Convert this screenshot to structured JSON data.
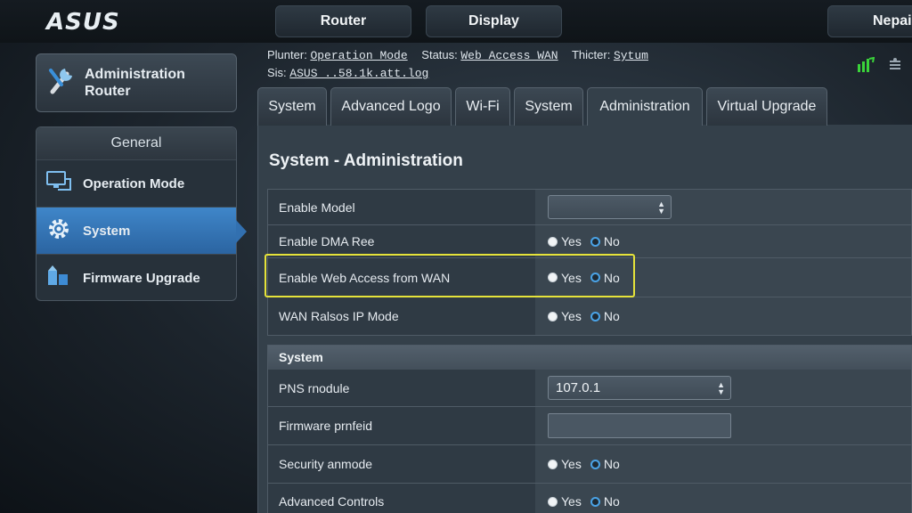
{
  "brand": {
    "logo": "ASUS"
  },
  "top_tabs": [
    "Router",
    "Display",
    "Nepail"
  ],
  "header": {
    "l1_k1": "Plunter:",
    "l1_v1": "Operation Mode",
    "l1_k2": "Status:",
    "l1_v2": "Web Access WAN",
    "l1_k3": "Thicter:",
    "l1_v3": "Sytum",
    "l2_k1": "Sis:",
    "l2_v1": "ASUS ..58.1k.att.log"
  },
  "sidebar": {
    "admin_title_line1": "Administration",
    "admin_title_line2": "Router",
    "section_title": "General",
    "items": [
      {
        "label": "Operation Mode",
        "icon": "monitor-network-icon"
      },
      {
        "label": "System",
        "icon": "gear-icon"
      },
      {
        "label": "Firmware Upgrade",
        "icon": "firmware-upgrade-icon"
      }
    ],
    "active_item": "System"
  },
  "tabs": [
    "System",
    "Advanced Logo",
    "Wi-Fi",
    "System",
    "Administration",
    "Virtual Upgrade"
  ],
  "active_tab": "Administration",
  "page_title": "System - Administration",
  "radio_labels": {
    "yes": "Yes",
    "no": "No"
  },
  "admin_rows": [
    {
      "label": "Enable Model",
      "type": "select",
      "value": ""
    },
    {
      "label": "Enable DMA Ree",
      "type": "radio",
      "selected": "No"
    },
    {
      "label": "Enable Web Access from WAN",
      "type": "radio",
      "selected": "No"
    },
    {
      "label": "WAN Ralsos IP Mode",
      "type": "radio",
      "selected": "No"
    }
  ],
  "system_section": {
    "title": "System",
    "rows": [
      {
        "label": "PNS rnodule",
        "type": "select",
        "value": "107.0.1"
      },
      {
        "label": "Firmware prnfeid",
        "type": "text",
        "value": ""
      },
      {
        "label": "Security anmode",
        "type": "radio",
        "selected": "No"
      },
      {
        "label": "Advanced Controls",
        "type": "radio",
        "selected": "No"
      }
    ]
  },
  "colors": {
    "accent": "#3a7cc0",
    "highlight": "#e6e33a",
    "status_green": "#3ad33a"
  }
}
